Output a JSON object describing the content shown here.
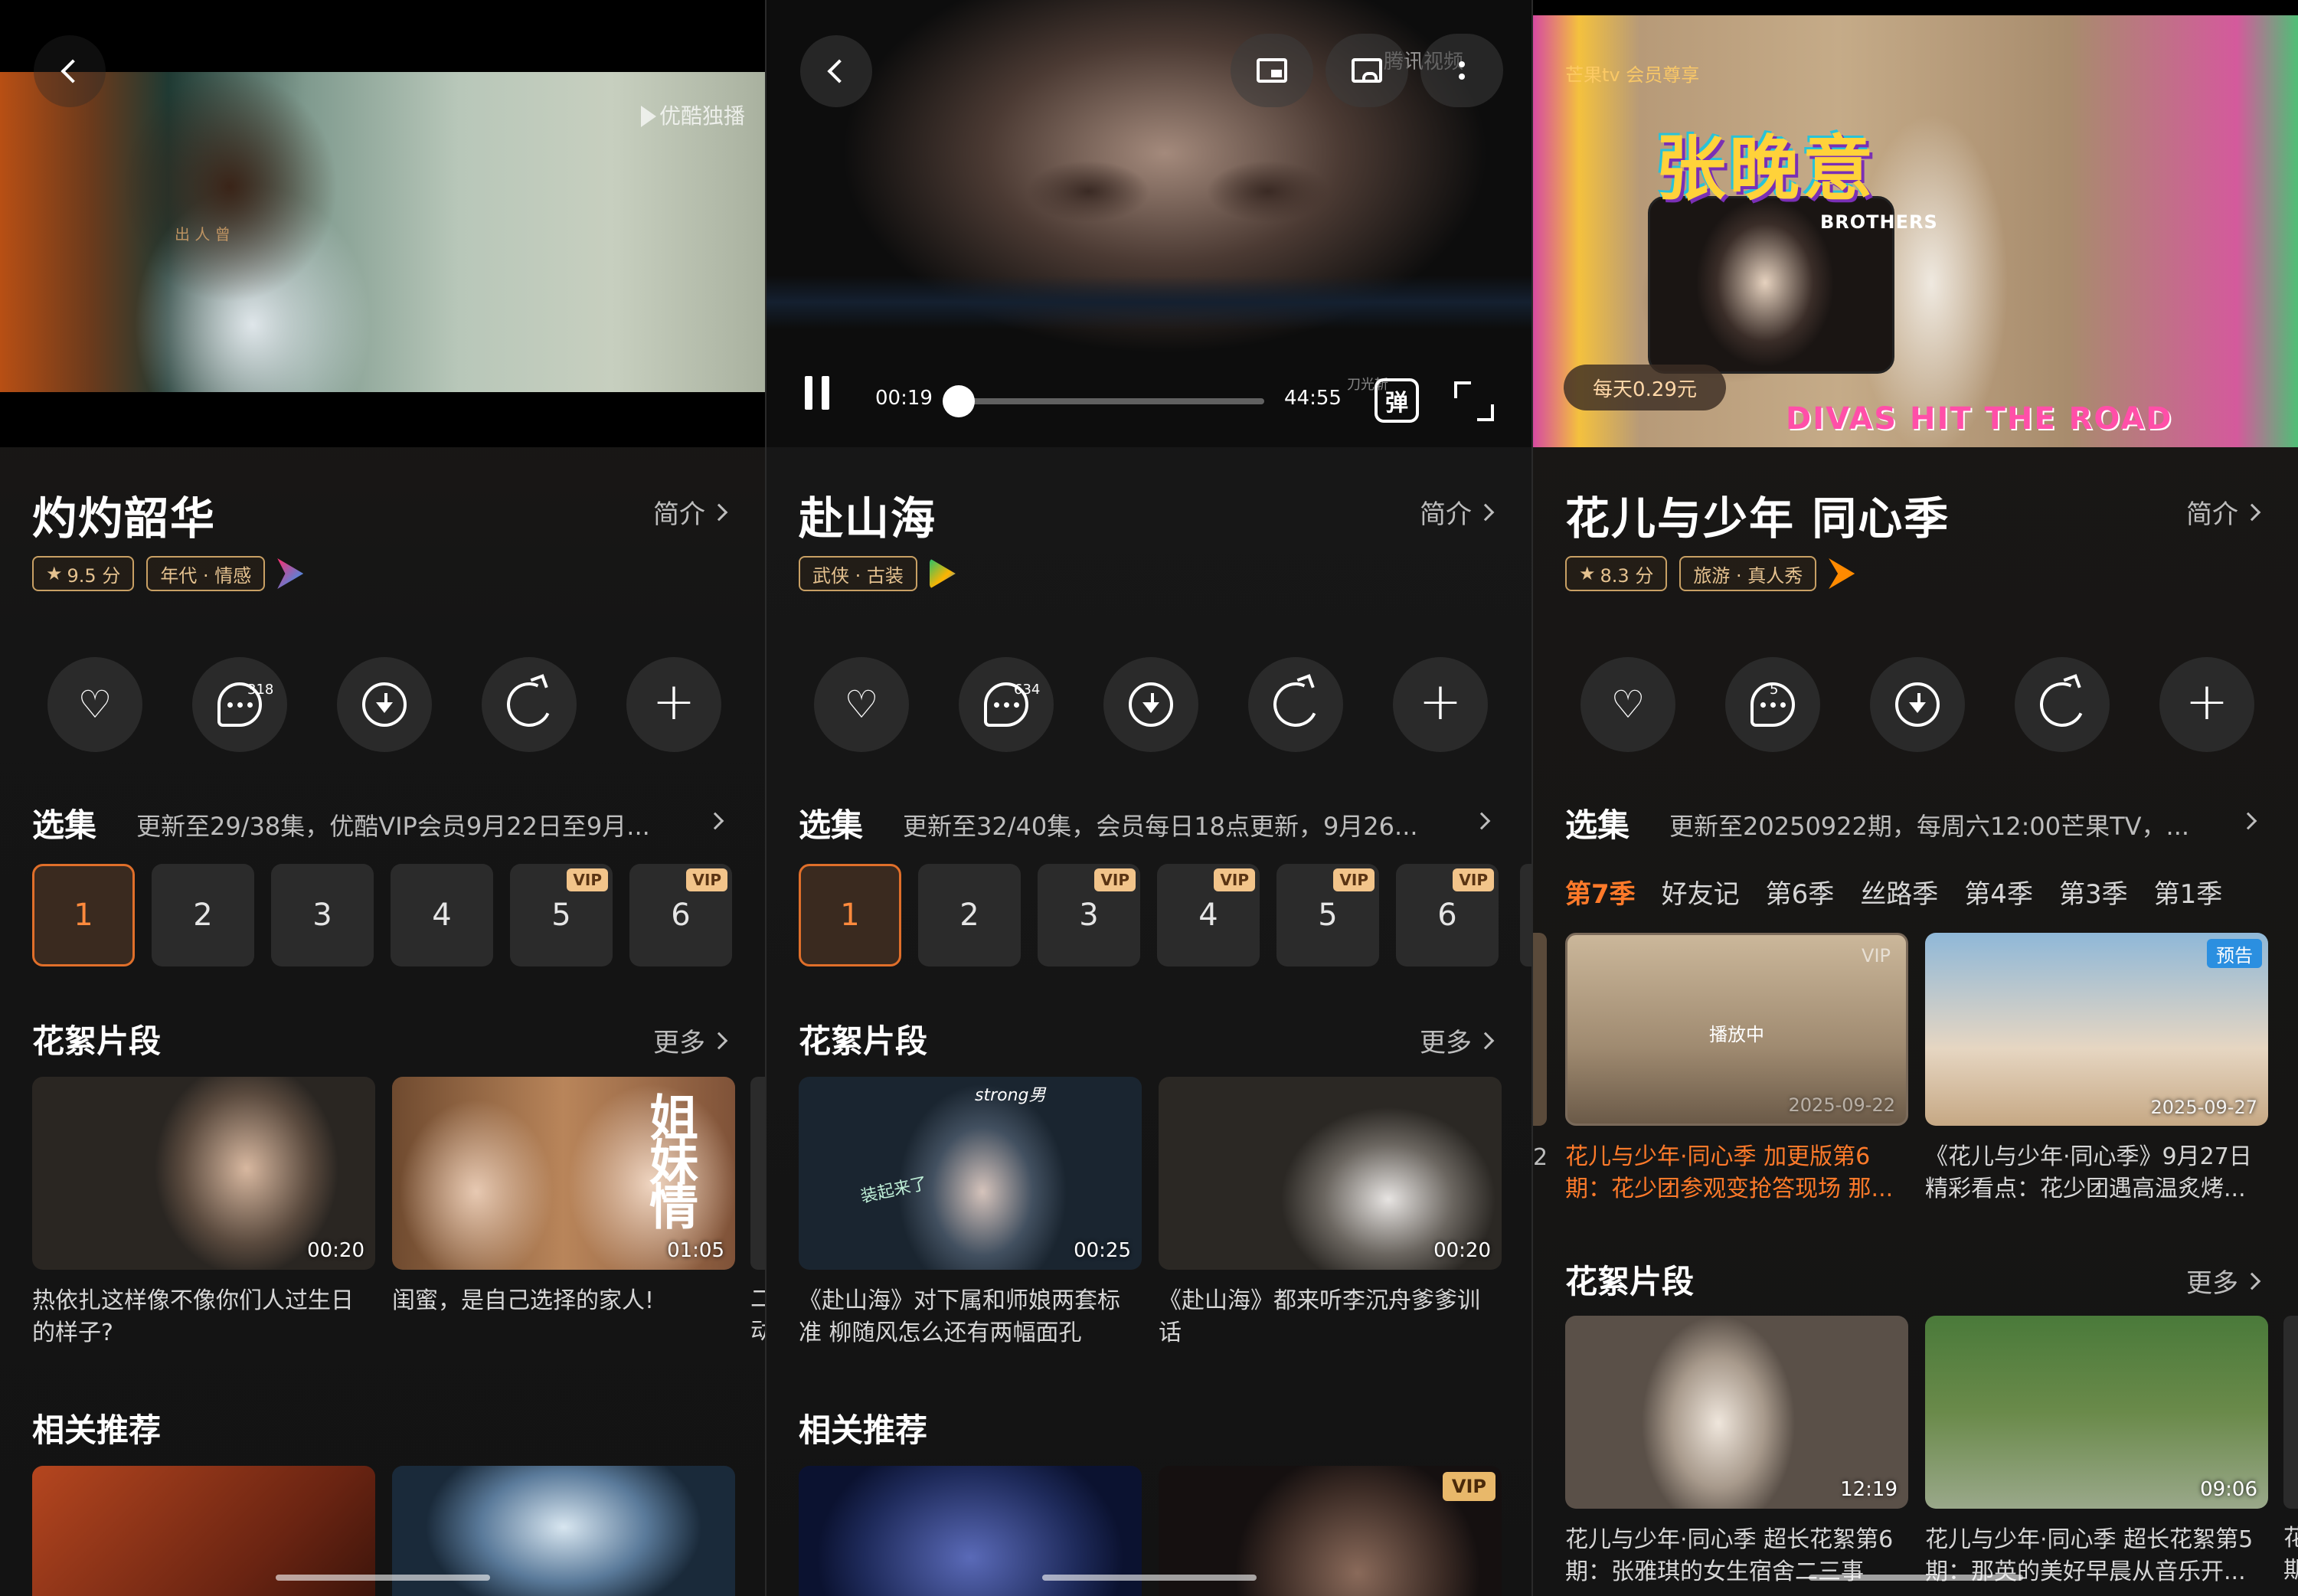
{
  "panels": [
    {
      "watermark": "优酷独播",
      "video_text": "出 人 曾",
      "title": "灼灼韶华",
      "intro": "简介",
      "rating": "9.5 分",
      "genre": "年代 · 情感",
      "platform_icon": "youku-icon",
      "counts": {
        "comments": "318"
      },
      "episodes_header": "选集",
      "episodes_sub": "更新至29/38集，优酷VIP会员9月22日至9月...",
      "episodes": [
        {
          "num": "1",
          "vip": ""
        },
        {
          "num": "2",
          "vip": ""
        },
        {
          "num": "3",
          "vip": ""
        },
        {
          "num": "4",
          "vip": ""
        },
        {
          "num": "5",
          "vip": "VIP"
        },
        {
          "num": "6",
          "vip": "VIP"
        }
      ],
      "clips_header": "花絮片段",
      "more": "更多",
      "clips": [
        {
          "title": "热依扎这样像不像你们人过生日的样子?",
          "duration": "00:20"
        },
        {
          "title": "闺蜜，是自己选择的家人!",
          "duration": "01:05",
          "overlay": "姐妹情"
        }
      ],
      "clips_peek": "二动",
      "related_header": "相关推荐"
    },
    {
      "watermark": "腾讯视频",
      "title": "赴山海",
      "intro": "简介",
      "genre": "武侠 · 古装",
      "platform_icon": "tencent-video-icon",
      "player": {
        "current": "00:19",
        "duration": "44:55",
        "progress": 0.007,
        "danmu": "弹",
        "subtitle_hint": "刀光斩"
      },
      "counts": {
        "comments": "634"
      },
      "episodes_header": "选集",
      "episodes_sub": "更新至32/40集，会员每日18点更新，9月26...",
      "episodes": [
        {
          "num": "1",
          "vip": ""
        },
        {
          "num": "2",
          "vip": ""
        },
        {
          "num": "3",
          "vip": "VIP"
        },
        {
          "num": "4",
          "vip": "VIP"
        },
        {
          "num": "5",
          "vip": "VIP"
        },
        {
          "num": "6",
          "vip": "VIP"
        }
      ],
      "clips_header": "花絮片段",
      "more": "更多",
      "clips": [
        {
          "title": "《赴山海》对下属和师娘两套标准 柳随风怎么还有两幅面孔",
          "duration": "00:25",
          "overlay": "装起来了",
          "top_text": "strong男"
        },
        {
          "title": "《赴山海》都来听李沉舟爹爹训话",
          "duration": "00:20"
        }
      ],
      "related_header": "相关推荐",
      "related_tags": [
        "",
        "VIP"
      ]
    },
    {
      "watermark": "芒果tv 会员尊享",
      "art_title": "张晚意",
      "art_brothers": "BROTHERS",
      "art_divas": "DIVAS HIT THE ROAD",
      "price": "每天0.29元",
      "title": "花儿与少年 同心季",
      "intro": "简介",
      "rating": "8.3 分",
      "genre": "旅游 · 真人秀",
      "platform_icon": "mango-tv-icon",
      "counts": {
        "comments": "5"
      },
      "episodes_header": "选集",
      "episodes_sub": "更新至20250922期，每周六12:00芒果TV，...",
      "seasons": [
        "第7季",
        "好友记",
        "第6季",
        "丝路季",
        "第4季",
        "第3季",
        "第1季"
      ],
      "season_cards": [
        {
          "title": "花儿与少年·同心季 加更版第6期：花少团参观变抢答现场 那...",
          "date": "2025-09-22",
          "tag": "VIP",
          "status": "播放中"
        },
        {
          "title": "《花儿与少年·同心季》9月27日精彩看点：花少团遇高温炙烤...",
          "date": "2025-09-27",
          "tag": "预告"
        }
      ],
      "season_peek": "2",
      "clips_header": "花絮片段",
      "more": "更多",
      "clips": [
        {
          "title": "花儿与少年·同心季 超长花絮第6期：张雅琪的女生宿舍二三事",
          "duration": "12:19"
        },
        {
          "title": "花儿与少年·同心季 超长花絮第5期：那英的美好早晨从音乐开...",
          "duration": "09:06"
        }
      ],
      "clips_peek": "花期"
    }
  ]
}
